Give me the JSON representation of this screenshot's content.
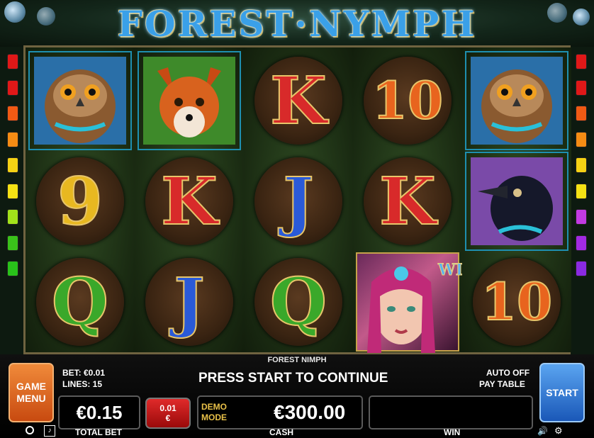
{
  "game": {
    "title": "FOREST·NYMPH",
    "name_small": "FOREST NIMPH"
  },
  "reels": [
    [
      "owl",
      "nine",
      "queen"
    ],
    [
      "fox",
      "king",
      "jack"
    ],
    [
      "king",
      "jack",
      "queen"
    ],
    [
      "ten",
      "king",
      "wild"
    ],
    [
      "owl",
      "raven",
      "ten"
    ]
  ],
  "symbols": {
    "nine": {
      "text": "9",
      "color": "#e8b820"
    },
    "ten": {
      "text": "10",
      "color": "#e8641e"
    },
    "jack": {
      "text": "J",
      "color": "#2a5ad8"
    },
    "queen": {
      "text": "Q",
      "color": "#3aa82a"
    },
    "king": {
      "text": "K",
      "color": "#d82a2a"
    },
    "wild": {
      "text": "WILD"
    }
  },
  "panel": {
    "game_menu_label": "GAME\nMENU",
    "bet_label": "BET: €0.01",
    "lines_label": "LINES: 15",
    "message": "PRESS START TO CONTINUE",
    "auto_label": "AUTO OFF",
    "paytable_label": "PAY TABLE",
    "start_label": "START",
    "total_bet_value": "€0.15",
    "total_bet_caption": "TOTAL BET",
    "denom_value": "0.01",
    "denom_currency": "€",
    "demo_mode_label": "DEMO\nMODE",
    "cash_value": "€300.00",
    "cash_caption": "CASH",
    "win_value": "",
    "win_caption": "WIN"
  },
  "colors": {
    "left_lights": [
      "#e01818",
      "#e01818",
      "#f05a14",
      "#f58c14",
      "#f5d214",
      "#f5e214",
      "#a2e21a",
      "#3ac21a",
      "#29c21a"
    ],
    "right_lights": [
      "#e01818",
      "#e01818",
      "#f05a14",
      "#f58c14",
      "#f5d214",
      "#f5e214",
      "#c23ae2",
      "#a22ae2",
      "#8a2ae2"
    ],
    "game_menu_bg": "#e2641c",
    "start_bg": "#2a78d8",
    "denom_bg": "#c21818",
    "accent_gold": "#e8c048"
  }
}
